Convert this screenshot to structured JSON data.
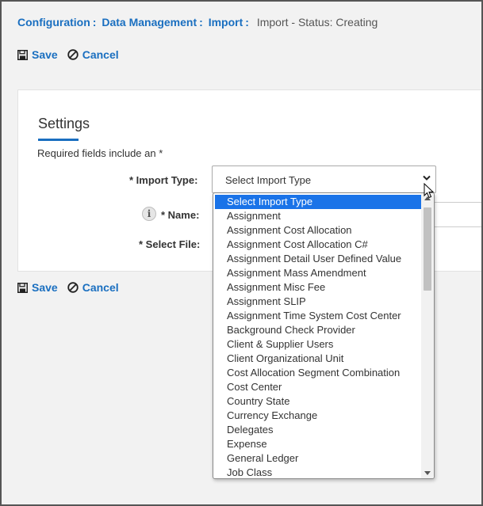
{
  "breadcrumb": {
    "items": [
      "Configuration",
      "Data Management",
      "Import"
    ],
    "separator": ":",
    "current": "Import - Status: Creating"
  },
  "actions": {
    "save_label": "Save",
    "cancel_label": "Cancel"
  },
  "settings": {
    "title": "Settings",
    "required_note": "Required fields include an *",
    "import_type_label": "* Import Type:",
    "name_label": "* Name:",
    "select_file_label": "* Select File:",
    "import_type_value": "Select Import Type"
  },
  "dropdown": {
    "options": [
      "Select Import Type",
      "Assignment",
      "Assignment Cost Allocation",
      "Assignment Cost Allocation C#",
      "Assignment Detail User Defined Value",
      "Assignment Mass Amendment",
      "Assignment Misc Fee",
      "Assignment SLIP",
      "Assignment Time System Cost Center",
      "Background Check Provider",
      "Client & Supplier Users",
      "Client Organizational Unit",
      "Cost Allocation Segment Combination",
      "Cost Center",
      "Country State",
      "Currency Exchange",
      "Delegates",
      "Expense",
      "General Ledger",
      "Job Class"
    ],
    "selected_index": 0
  },
  "colors": {
    "accent": "#1a6fc0",
    "selected_bg": "#1a73e8"
  },
  "icons": {
    "save": "floppy-disk-icon",
    "cancel": "cancel-circle-icon",
    "info": "info-icon",
    "chevron": "chevron-down-icon"
  }
}
